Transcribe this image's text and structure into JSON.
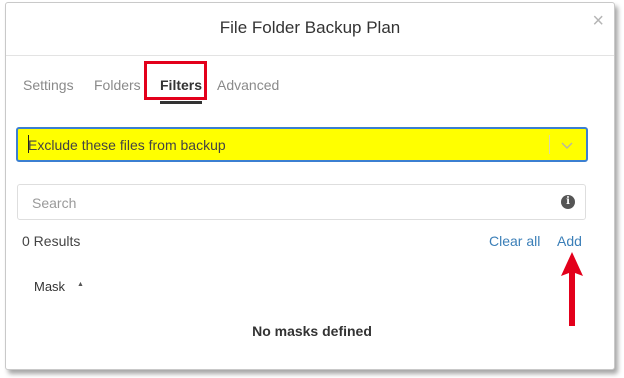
{
  "dialog": {
    "title": "File Folder Backup Plan",
    "close_glyph": "×"
  },
  "tabs": [
    {
      "label": "Settings",
      "active": false
    },
    {
      "label": "Folders",
      "active": false
    },
    {
      "label": "Filters",
      "active": true
    },
    {
      "label": "Advanced",
      "active": false
    }
  ],
  "filter_mode": {
    "selected": "Exclude these files from backup",
    "highlight_color": "#ffff00"
  },
  "search": {
    "placeholder": "Search",
    "value": "",
    "info_icon": "info-icon"
  },
  "results": {
    "count_label": "0 Results",
    "clear_all": "Clear all",
    "add": "Add"
  },
  "table": {
    "column": "Mask",
    "sort": "ascending",
    "empty_message": "No masks defined"
  },
  "annotation_color": "#e3001b",
  "link_color": "#3b7fb8"
}
